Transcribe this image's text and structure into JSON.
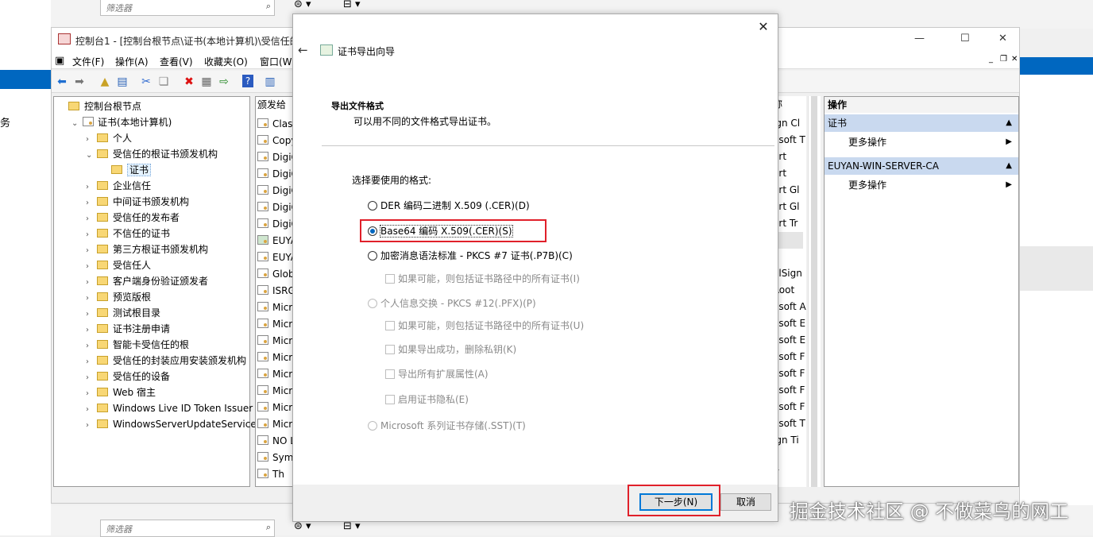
{
  "background": {
    "filter_placeholder_top": "筛选器",
    "filter_placeholder_bottom": "筛选器",
    "side_char": "务"
  },
  "mmc": {
    "title": "控制台1 - [控制台根节点\\证书(本地计算机)\\受信任的",
    "menus": [
      "文件(F)",
      "操作(A)",
      "查看(V)",
      "收藏夹(O)",
      "窗口(W"
    ],
    "tree": [
      {
        "label": "控制台根节点",
        "level": 0,
        "expand": "",
        "icon": "folder"
      },
      {
        "label": "证书(本地计算机)",
        "level": 1,
        "expand": "v",
        "icon": "cert"
      },
      {
        "label": "个人",
        "level": 2,
        "expand": ">",
        "icon": "folder"
      },
      {
        "label": "受信任的根证书颁发机构",
        "level": 2,
        "expand": "v",
        "icon": "folder"
      },
      {
        "label": "证书",
        "level": 3,
        "expand": "",
        "icon": "folder",
        "selected": true
      },
      {
        "label": "企业信任",
        "level": 2,
        "expand": ">",
        "icon": "folder"
      },
      {
        "label": "中间证书颁发机构",
        "level": 2,
        "expand": ">",
        "icon": "folder"
      },
      {
        "label": "受信任的发布者",
        "level": 2,
        "expand": ">",
        "icon": "folder"
      },
      {
        "label": "不信任的证书",
        "level": 2,
        "expand": ">",
        "icon": "folder"
      },
      {
        "label": "第三方根证书颁发机构",
        "level": 2,
        "expand": ">",
        "icon": "folder"
      },
      {
        "label": "受信任人",
        "level": 2,
        "expand": ">",
        "icon": "folder"
      },
      {
        "label": "客户端身份验证颁发者",
        "level": 2,
        "expand": ">",
        "icon": "folder"
      },
      {
        "label": "预览版根",
        "level": 2,
        "expand": ">",
        "icon": "folder"
      },
      {
        "label": "测试根目录",
        "level": 2,
        "expand": ">",
        "icon": "folder"
      },
      {
        "label": "证书注册申请",
        "level": 2,
        "expand": ">",
        "icon": "folder"
      },
      {
        "label": "智能卡受信任的根",
        "level": 2,
        "expand": ">",
        "icon": "folder"
      },
      {
        "label": "受信任的封装应用安装颁发机构",
        "level": 2,
        "expand": ">",
        "icon": "folder"
      },
      {
        "label": "受信任的设备",
        "level": 2,
        "expand": ">",
        "icon": "folder"
      },
      {
        "label": "Web 宿主",
        "level": 2,
        "expand": ">",
        "icon": "folder"
      },
      {
        "label": "Windows Live ID Token Issuer",
        "level": 2,
        "expand": ">",
        "icon": "folder"
      },
      {
        "label": "WindowsServerUpdateServices",
        "level": 2,
        "expand": ">",
        "icon": "folder"
      }
    ],
    "list_header": "颁发给",
    "list_rows": [
      "Class",
      "Copy",
      "DigiC",
      "DigiC",
      "DigiC",
      "DigiC",
      "DigiC",
      "EUYA",
      "EUYA",
      "Glob",
      "ISRG",
      "Micr",
      "Micr",
      "Micr",
      "Micr",
      "Micr",
      "Micr",
      "Micr",
      "Micr",
      "NO L",
      "Syma",
      "Th"
    ],
    "list2_header": "称",
    "list2_rows": [
      "ign Cl",
      "osoft T",
      "ert",
      "ert",
      "ert Gl",
      "ert Gl",
      "ert Tr",
      "",
      "",
      "alSign",
      "Root",
      "osoft A",
      "osoft E",
      "osoft E",
      "osoft F",
      "osoft F",
      "osoft F",
      "osoft F",
      "osoft T",
      "ign Ti",
      "",
      "T"
    ],
    "actions": {
      "header": "操作",
      "section1": "证书",
      "section1_item": "更多操作",
      "section2": "EUYAN-WIN-SERVER-CA",
      "section2_item": "更多操作"
    }
  },
  "dialog": {
    "title": "证书导出向导",
    "section_title": "导出文件格式",
    "section_desc": "可以用不同的文件格式导出证书。",
    "prompt": "选择要使用的格式:",
    "options": [
      {
        "label": "DER 编码二进制 X.509 (.CER)(D)",
        "type": "radio",
        "checked": false,
        "disabled": false
      },
      {
        "label": "Base64 编码 X.509(.CER)(S)",
        "type": "radio",
        "checked": true,
        "disabled": false
      },
      {
        "label": "加密消息语法标准 - PKCS #7 证书(.P7B)(C)",
        "type": "radio",
        "checked": false,
        "disabled": false
      },
      {
        "label": "如果可能，则包括证书路径中的所有证书(I)",
        "type": "checkbox",
        "checked": false,
        "disabled": true
      },
      {
        "label": "个人信息交换 - PKCS #12(.PFX)(P)",
        "type": "radio",
        "checked": false,
        "disabled": true
      },
      {
        "label": "如果可能，则包括证书路径中的所有证书(U)",
        "type": "checkbox",
        "checked": false,
        "disabled": true
      },
      {
        "label": "如果导出成功，删除私钥(K)",
        "type": "checkbox",
        "checked": false,
        "disabled": true
      },
      {
        "label": "导出所有扩展属性(A)",
        "type": "checkbox",
        "checked": false,
        "disabled": true
      },
      {
        "label": "启用证书隐私(E)",
        "type": "checkbox",
        "checked": false,
        "disabled": true
      },
      {
        "label": "Microsoft 系列证书存储(.SST)(T)",
        "type": "radio",
        "checked": false,
        "disabled": true
      }
    ],
    "next_button": "下一步(N)",
    "cancel_button": "取消"
  },
  "watermark": "掘金技术社区 @ 不做菜鸟的网工",
  "colors": {
    "accent": "#0067c0",
    "highlight": "#e0202a"
  }
}
